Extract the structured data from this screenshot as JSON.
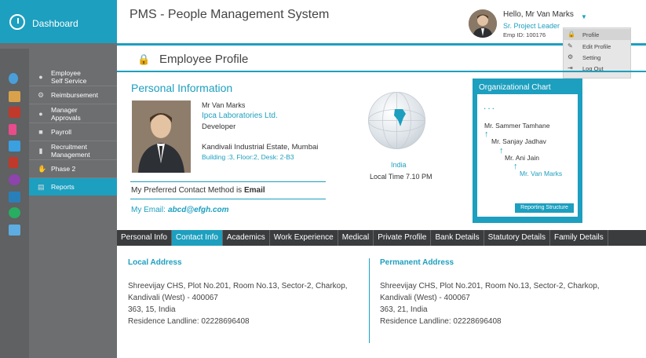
{
  "dashboard": {
    "label": "Dashboard"
  },
  "app": {
    "title": "PMS - People Management System"
  },
  "user": {
    "greeting": "Hello, Mr Van Marks",
    "role": "Sr. Project Leader",
    "emp_id": "Emp ID: 100176"
  },
  "user_menu": {
    "items": [
      {
        "label": "Profile",
        "icon": "lock-icon"
      },
      {
        "label": "Edit Profile",
        "icon": "edit-icon"
      },
      {
        "label": "Setting",
        "icon": "gear-icon"
      },
      {
        "label": "Log Out",
        "icon": "logout-icon"
      }
    ]
  },
  "side_menu": {
    "items": [
      {
        "line1": "Employee",
        "line2": "Self Service"
      },
      {
        "line1": "Reimbursement",
        "line2": ""
      },
      {
        "line1": "Manager",
        "line2": "Approvals"
      },
      {
        "line1": "Payroll",
        "line2": ""
      },
      {
        "line1": "Recruitment",
        "line2": "Management"
      },
      {
        "line1": "Phase 2",
        "line2": ""
      },
      {
        "line1": "Reports",
        "line2": ""
      }
    ]
  },
  "page": {
    "title": "Employee Profile"
  },
  "personal": {
    "section_title": "Personal Information",
    "name": "Mr Van Marks",
    "company": "Ipca Laboratories Ltd.",
    "designation": "Developer",
    "address_line1": "Kandivali Industrial Estate, Mumbai",
    "address_line2": "Building :3, Floor:2, Desk: 2-B3",
    "contact_prefix": "My Preferred Contact Method is ",
    "contact_method": "Email",
    "email_label": "My Email: ",
    "email": "abcd@efgh.com"
  },
  "location": {
    "country": "India",
    "local_time": "Local Time 7.10 PM"
  },
  "org_chart": {
    "title": "Organizational Chart",
    "dots": "...",
    "people": [
      "Mr. Sammer Tamhane",
      "Mr. Sanjay Jadhav",
      "Mr. Ani Jain",
      "Mr. Van Marks"
    ],
    "button": "Reporting Structure"
  },
  "tabs": [
    "Personal Info",
    "Contact Info",
    "Academics",
    "Work Experience",
    "Medical",
    "Private Profile",
    "Bank Details",
    "Statutory Details",
    "Family Details"
  ],
  "local_address": {
    "title": "Local Address",
    "lines": [
      "Shreevijay CHS, Plot No.201, Room No.13, Sector-2, Charkop,",
      "Kandivali (West) - 400067",
      "363, 15, India",
      "Residence Landline: 02228696408"
    ]
  },
  "permanent_address": {
    "title": "Permanent Address",
    "lines": [
      "Shreevijay CHS, Plot No.201, Room No.13, Sector-2, Charkop,",
      "Kandivali (West) - 400067",
      "363, 21, India",
      "Residence Landline: 02228696408"
    ]
  },
  "colors": {
    "accent": "#1d9fbf",
    "sidebar": "#6c6e70",
    "tabbar": "#3a3c3e"
  }
}
